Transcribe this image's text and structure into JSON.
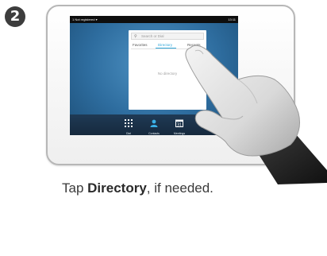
{
  "step": {
    "number": "2"
  },
  "statusbar": {
    "left_text": "1 Not registered  ▾",
    "right_text": "13:11"
  },
  "directory": {
    "search_placeholder": "Search or Dial",
    "tabs": [
      {
        "label": "Favorites",
        "active": false
      },
      {
        "label": "Directory",
        "active": true
      },
      {
        "label": "Recents",
        "active": false
      }
    ],
    "empty_message": "No directory"
  },
  "dock": {
    "items": [
      {
        "label": "Dial"
      },
      {
        "label": "Contacts"
      },
      {
        "label": "Meetings"
      }
    ]
  },
  "caption": {
    "prefix": "Tap ",
    "bold": "Directory",
    "suffix": ", if needed."
  },
  "colors": {
    "accent": "#2fa6d9",
    "screen_blue": "#3b7fb3",
    "dock": "#1c3550"
  },
  "icons": [
    "search-icon",
    "keypad-icon",
    "contacts-icon",
    "calendar-icon",
    "pointing-hand-icon"
  ]
}
